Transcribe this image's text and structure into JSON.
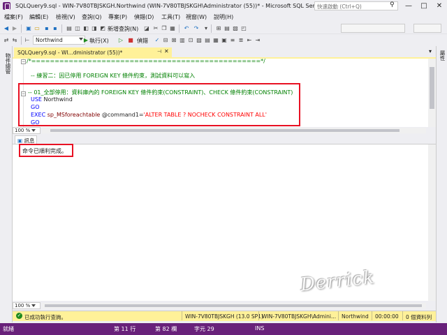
{
  "window": {
    "title": "SQLQuery9.sql - WIN-7V80TBJSKGH.Northwind (WIN-7V80TBJSKGH\\Administrator (55))* - Microsoft SQL Server Mana...",
    "quick_launch_placeholder": "快速啟動 (Ctrl+Q)",
    "quick_launch_icon": "search-icon",
    "minimize": "—",
    "maximize": "□",
    "close": "✕"
  },
  "menu": [
    "檔案(F)",
    "編輯(E)",
    "檢視(V)",
    "查詢(Q)",
    "專案(P)",
    "偵錯(D)",
    "工具(T)",
    "視窗(W)",
    "說明(H)"
  ],
  "toolbar": {
    "new_query": "新增查詢(N)",
    "database": "Northwind",
    "execute": "執行(X)",
    "debug": "偵錯"
  },
  "side_rails": {
    "left": "物件總管",
    "right": "屬性"
  },
  "tab": {
    "label": "SQLQuery9.sql - WI...dministrator (55))*",
    "pin": "⊣",
    "close": "✕",
    "dropdown": "▾"
  },
  "editor": {
    "lines": {
      "line1": "/*=================================================*/",
      "line2": "-- 練習二：因已停用 FOREIGN KEY 條件約束，測試資料可以寫入",
      "line3": "-- 01_全部停用：資料庫內的 FOREIGN KEY 條件約束(CONSTRAINT)、CHECK 條件約束(CONSTRAINT)",
      "line4_kw": "USE",
      "line4_rest": " Northwind",
      "line5": "GO",
      "line6_kw": "EXEC",
      "line6_sp": " sp_MSforeachtable",
      "line6_param": " @command1",
      "line6_eq": "=",
      "line6_str": "'ALTER TABLE ? NOCHECK CONSTRAINT ALL'",
      "line7": "GO"
    },
    "zoom": "100 %"
  },
  "results": {
    "tab": "訊息",
    "message": "命令已順利完成。",
    "zoom": "100 %"
  },
  "query_status": {
    "status": "已成功執行查詢。",
    "server": "WIN-7V80TBJSKGH (13.0 SP1)",
    "user": "WIN-7V80TBJSKGH\\Admini...",
    "database": "Northwind",
    "time": "00:00:00",
    "rows": "0 個資料列"
  },
  "statusbar": {
    "ready": "就緒",
    "line": "第 11 行",
    "col": "第 82 欄",
    "char": "字元 29",
    "mode": "INS"
  },
  "watermark": "Derrick",
  "colors": {
    "status_purple": "#68217a",
    "tab_yellow": "#fff199",
    "highlight_red": "#e81123"
  }
}
